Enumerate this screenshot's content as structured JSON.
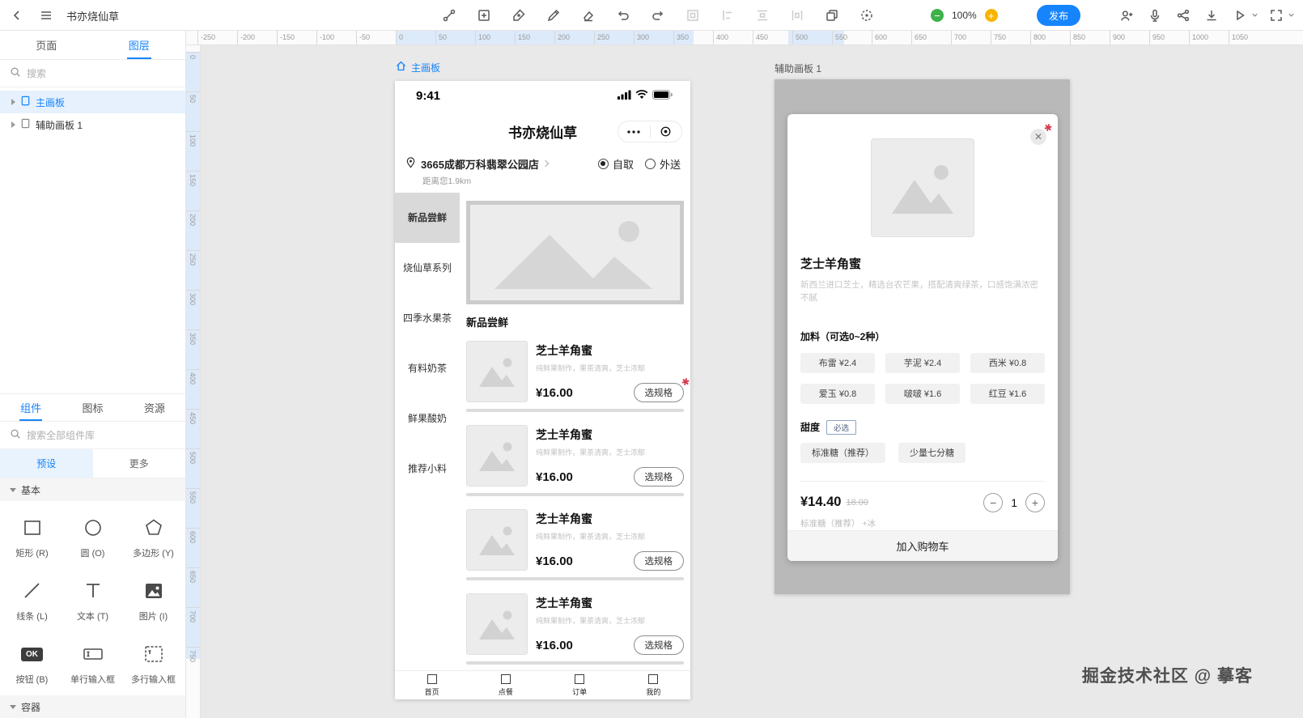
{
  "toolbar": {
    "title": "书亦烧仙草",
    "zoom_level": "100%",
    "publish_label": "发布"
  },
  "sidebar": {
    "panel_tabs": {
      "pages": "页面",
      "layers": "图层"
    },
    "search_placeholder": "搜索",
    "layers": [
      {
        "label": "主画板"
      },
      {
        "label": "辅助画板 1"
      }
    ],
    "library_tabs": {
      "components": "组件",
      "icons": "图标",
      "resources": "资源"
    },
    "library_search_placeholder": "搜索全部组件库",
    "preset_tabs": {
      "presets": "预设",
      "more": "更多"
    },
    "sections": {
      "basic": "基本",
      "container": "容器"
    },
    "components": [
      {
        "label": "矩形 (R)"
      },
      {
        "label": "圆 (O)"
      },
      {
        "label": "多边形 (Y)"
      },
      {
        "label": "线条 (L)"
      },
      {
        "label": "文本 (T)"
      },
      {
        "label": "图片 (I)"
      },
      {
        "label": "按钮 (B)",
        "icon_text": "OK"
      },
      {
        "label": "单行输入框"
      },
      {
        "label": "多行输入框"
      }
    ]
  },
  "ruler": {
    "h_ticks": [
      -250,
      -200,
      -150,
      -100,
      -50,
      0,
      50,
      100,
      150,
      200,
      250,
      300,
      350,
      400,
      450,
      500,
      550,
      600,
      650,
      700,
      750,
      800,
      850,
      900,
      950,
      1000,
      1050
    ],
    "v_ticks": [
      0,
      50,
      100,
      150,
      200,
      250,
      300,
      350,
      400,
      450,
      500,
      550,
      600,
      650,
      700,
      750
    ]
  },
  "canvas": {
    "main_artboard_label": "主画板",
    "aux_artboard_label": "辅助画板 1",
    "phone": {
      "status_time": "9:41",
      "store_name": "书亦烧仙草",
      "store_address": "3665成都万科翡翠公园店",
      "distance": "距离您1.9km",
      "order_modes": {
        "pickup": "自取",
        "delivery": "外送"
      },
      "categories": [
        {
          "label": "新品尝鲜"
        },
        {
          "label": "烧仙草系列"
        },
        {
          "label": "四季水果茶"
        },
        {
          "label": "有料奶茶"
        },
        {
          "label": "鲜果酸奶"
        },
        {
          "label": "推荐小料"
        }
      ],
      "section_title": "新品尝鲜",
      "products": [
        {
          "name": "芝士羊角蜜",
          "desc": "纯鲜果制作，果茶清爽，芝士浓郁",
          "price": "¥16.00",
          "action": "选规格"
        },
        {
          "name": "芝士羊角蜜",
          "desc": "纯鲜果制作，果茶清爽，芝士浓郁",
          "price": "¥16.00",
          "action": "选规格"
        },
        {
          "name": "芝士羊角蜜",
          "desc": "纯鲜果制作，果茶清爽，芝士浓郁",
          "price": "¥16.00",
          "action": "选规格"
        },
        {
          "name": "芝士羊角蜜",
          "desc": "纯鲜果制作，果茶清爽，芝士浓郁",
          "price": "¥16.00",
          "action": "选规格"
        }
      ],
      "tabbar": [
        {
          "label": "首页"
        },
        {
          "label": "点餐"
        },
        {
          "label": "订单"
        },
        {
          "label": "我的"
        }
      ]
    },
    "modal": {
      "title": "芝士羊角蜜",
      "description": "新西兰进口芝士，精选台农芒果，搭配清爽绿茶，口感饱满浓密不腻",
      "addons_label": "加料（可选0~2种）",
      "addons": [
        "布雷 ¥2.4",
        "芋泥 ¥2.4",
        "西米 ¥0.8",
        "爱玉 ¥0.8",
        "啵啵 ¥1.6",
        "红豆 ¥1.6"
      ],
      "sweetness_label": "甜度",
      "required_badge": "必选",
      "sweetness_options": [
        "标准糖（推荐）",
        "少量七分糖"
      ],
      "price": "¥14.40",
      "original_price": "18.00",
      "selected_spec": "标准糖（推荐） +冰",
      "quantity": "1",
      "add_to_cart_label": "加入购物车"
    }
  },
  "watermark": "掘金技术社区 @ 摹客"
}
